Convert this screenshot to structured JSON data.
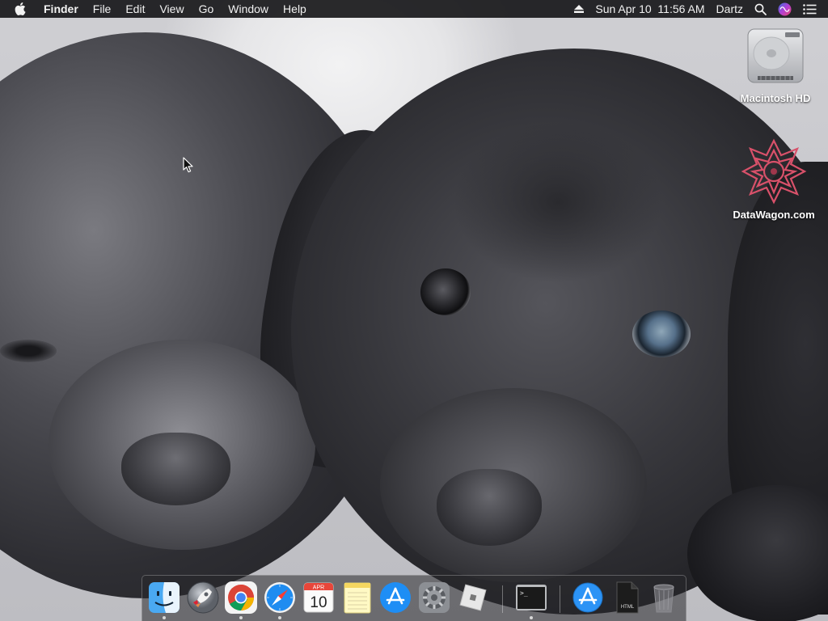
{
  "menubar": {
    "apple_icon": "apple-logo-icon",
    "app_name": "Finder",
    "menus": [
      "File",
      "Edit",
      "View",
      "Go",
      "Window",
      "Help"
    ],
    "datetime": "Sun Apr 10  11:56 AM",
    "user": "Dartz",
    "status_icons": [
      "eject-icon",
      "search-icon",
      "siri-icon",
      "notification-center-icon"
    ]
  },
  "desktop": {
    "icons": [
      {
        "label": "Macintosh HD",
        "icon": "hard-drive-icon"
      },
      {
        "label": "DataWagon.com",
        "icon": "datawagon-logo-icon"
      }
    ]
  },
  "dock": {
    "apps": [
      {
        "name": "Finder",
        "icon": "finder-icon",
        "running": true
      },
      {
        "name": "Launchpad",
        "icon": "launchpad-icon",
        "running": false
      },
      {
        "name": "Google Chrome",
        "icon": "chrome-icon",
        "running": true
      },
      {
        "name": "Safari",
        "icon": "safari-icon",
        "running": true
      },
      {
        "name": "Calendar",
        "icon": "calendar-icon",
        "running": false,
        "month": "APR",
        "day": "10"
      },
      {
        "name": "Notes",
        "icon": "notes-icon",
        "running": false
      },
      {
        "name": "App Store",
        "icon": "app-store-icon",
        "running": false
      },
      {
        "name": "System Preferences",
        "icon": "system-preferences-icon",
        "running": false
      },
      {
        "name": "Roblox",
        "icon": "roblox-icon",
        "running": false
      },
      {
        "name": "Terminal",
        "icon": "terminal-icon",
        "running": true,
        "prompt": ">_"
      },
      {
        "name": "Applications",
        "icon": "applications-folder-icon",
        "running": false
      },
      {
        "name": "Document",
        "icon": "html-document-icon",
        "running": false,
        "file_tag": "HTML"
      },
      {
        "name": "Trash",
        "icon": "trash-icon",
        "running": false
      }
    ]
  },
  "colors": {
    "menubar_bg": "#18181a",
    "menubar_text": "#f2f2f2",
    "safari_blue": "#1f8cf0",
    "appstore_blue": "#1e8ef5",
    "chrome_red": "#db4437",
    "chrome_yellow": "#f4b400",
    "chrome_green": "#0f9d58",
    "chrome_blue": "#4285f4"
  }
}
